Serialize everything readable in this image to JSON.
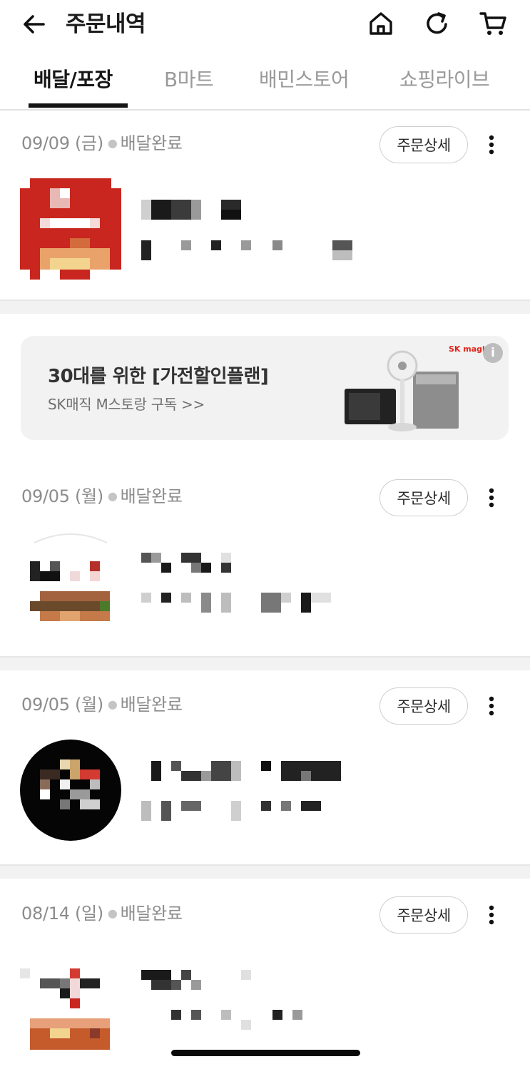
{
  "header": {
    "title": "주문내역",
    "icons": [
      "back-arrow-icon",
      "home-icon",
      "refresh-icon",
      "cart-icon"
    ]
  },
  "tabs": [
    {
      "label": "배달/포장",
      "active": true
    },
    {
      "label": "B마트",
      "active": false
    },
    {
      "label": "배민스토어",
      "active": false
    },
    {
      "label": "쇼핑라이브",
      "active": false
    }
  ],
  "orders": [
    {
      "date": "09/09 (금)",
      "status": "배달완료",
      "detail_label": "주문상세"
    },
    {
      "date": "09/05 (월)",
      "status": "배달완료",
      "detail_label": "주문상세"
    },
    {
      "date": "09/05 (월)",
      "status": "배달완료",
      "detail_label": "주문상세"
    },
    {
      "date": "08/14 (일)",
      "status": "배달완료",
      "detail_label": "주문상세"
    }
  ],
  "ad": {
    "title": "30대를 위한 [가전할인플랜]",
    "subtitle": "SK매직 M스토랑 구독 >>",
    "brand": "SK magic",
    "info_icon": "info-icon"
  },
  "colors": {
    "accent": "#141414",
    "muted_text": "#8c8c8c",
    "divider": "#f2f2f2",
    "brand_red": "#e2231a"
  }
}
